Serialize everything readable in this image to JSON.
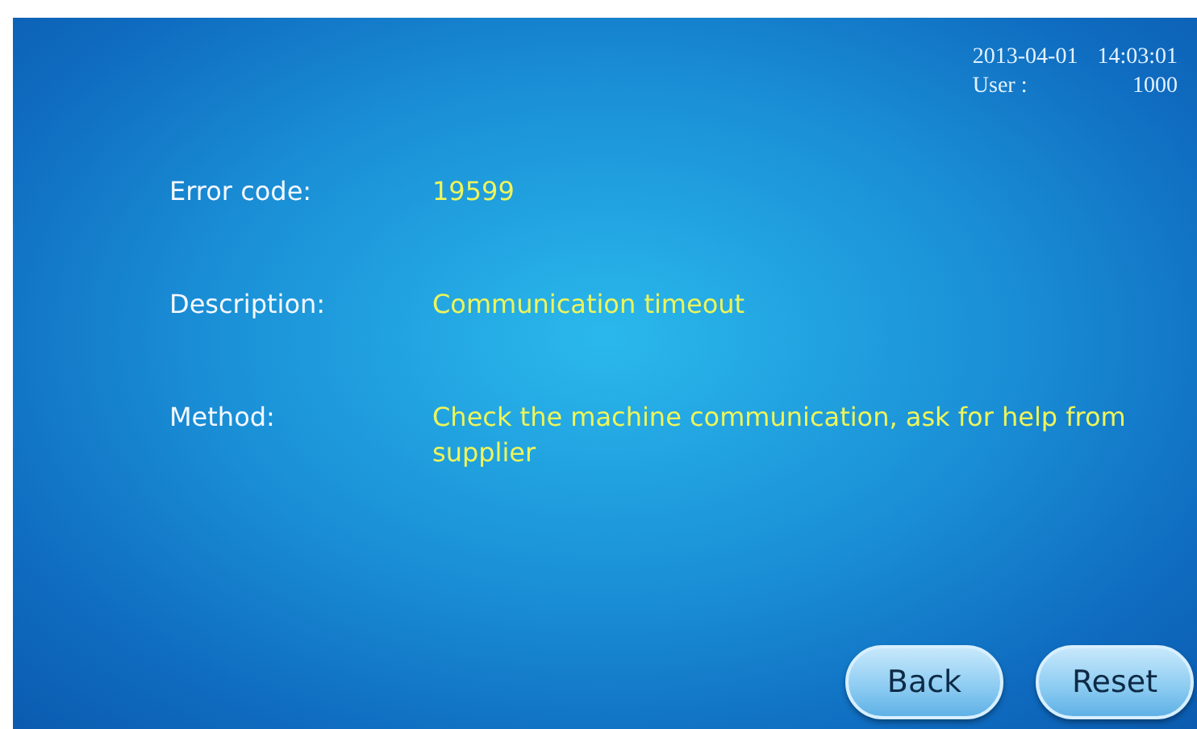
{
  "header": {
    "date": "2013-04-01",
    "time": "14:03:01",
    "user_label": "User :",
    "user_value": "1000"
  },
  "fields": [
    {
      "label": "Error code:",
      "value": "19599"
    },
    {
      "label": "Description:",
      "value": "Communication timeout"
    },
    {
      "label": "Method:",
      "value": "Check the machine communication, ask for help from supplier"
    }
  ],
  "buttons": [
    "Back",
    "Reset"
  ]
}
